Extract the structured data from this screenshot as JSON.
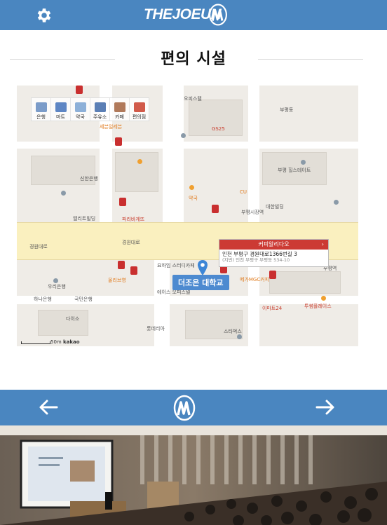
{
  "header": {
    "logo_text": "THEJOEUN",
    "settings_icon": "gear-icon",
    "brand_color": "#4a86c0"
  },
  "page": {
    "title": "편의 시설"
  },
  "map": {
    "categories": [
      {
        "label": "은행",
        "icon": "bank-icon"
      },
      {
        "label": "마트",
        "icon": "mart-icon"
      },
      {
        "label": "약국",
        "icon": "pharmacy-icon"
      },
      {
        "label": "주유소",
        "icon": "gas-station-icon"
      },
      {
        "label": "카페",
        "icon": "cafe-icon"
      },
      {
        "label": "편의점",
        "icon": "convenience-store-icon"
      }
    ],
    "popup": {
      "name": "커피알리다오",
      "address": "인천 부평구 경원대로1366번길 3",
      "sub_address": "(지번) 인천 부평구 부평동 534-10"
    },
    "campus_label": "더조은 대학교",
    "road_label_left": "경원대로",
    "road_label_right": "경원대로",
    "scale_label": "50m",
    "brand_label": "kakao",
    "pois": {
      "p1": "오피스텔",
      "p2": "부평동",
      "p3": "GS25",
      "p4": "이마트24",
      "p5": "세븐일레븐",
      "p6": "CU",
      "p7": "파리바게뜨",
      "p8": "우리은행",
      "p9": "신한은행",
      "p10": "부평시장역",
      "p11": "요하임 스터디카페",
      "p12": "에이스 오피스텔",
      "p13": "부평 힐스테이트",
      "p14": "메가MGC커피",
      "p15": "스타벅스",
      "p16": "투썸플레이스",
      "p17": "다이소",
      "p18": "올리브영",
      "p19": "약국",
      "p20": "하나은행",
      "p21": "국민은행",
      "p22": "부평역",
      "p23": "엘리트빌딩",
      "p24": "대한빌딩",
      "p25": "롯데리아"
    }
  },
  "footer_nav": {
    "prev_icon": "arrow-left-icon",
    "next_icon": "arrow-right-icon",
    "logo_icon": "brand-mark-icon"
  },
  "photo": {
    "subject": "lecture-hall-photo"
  }
}
